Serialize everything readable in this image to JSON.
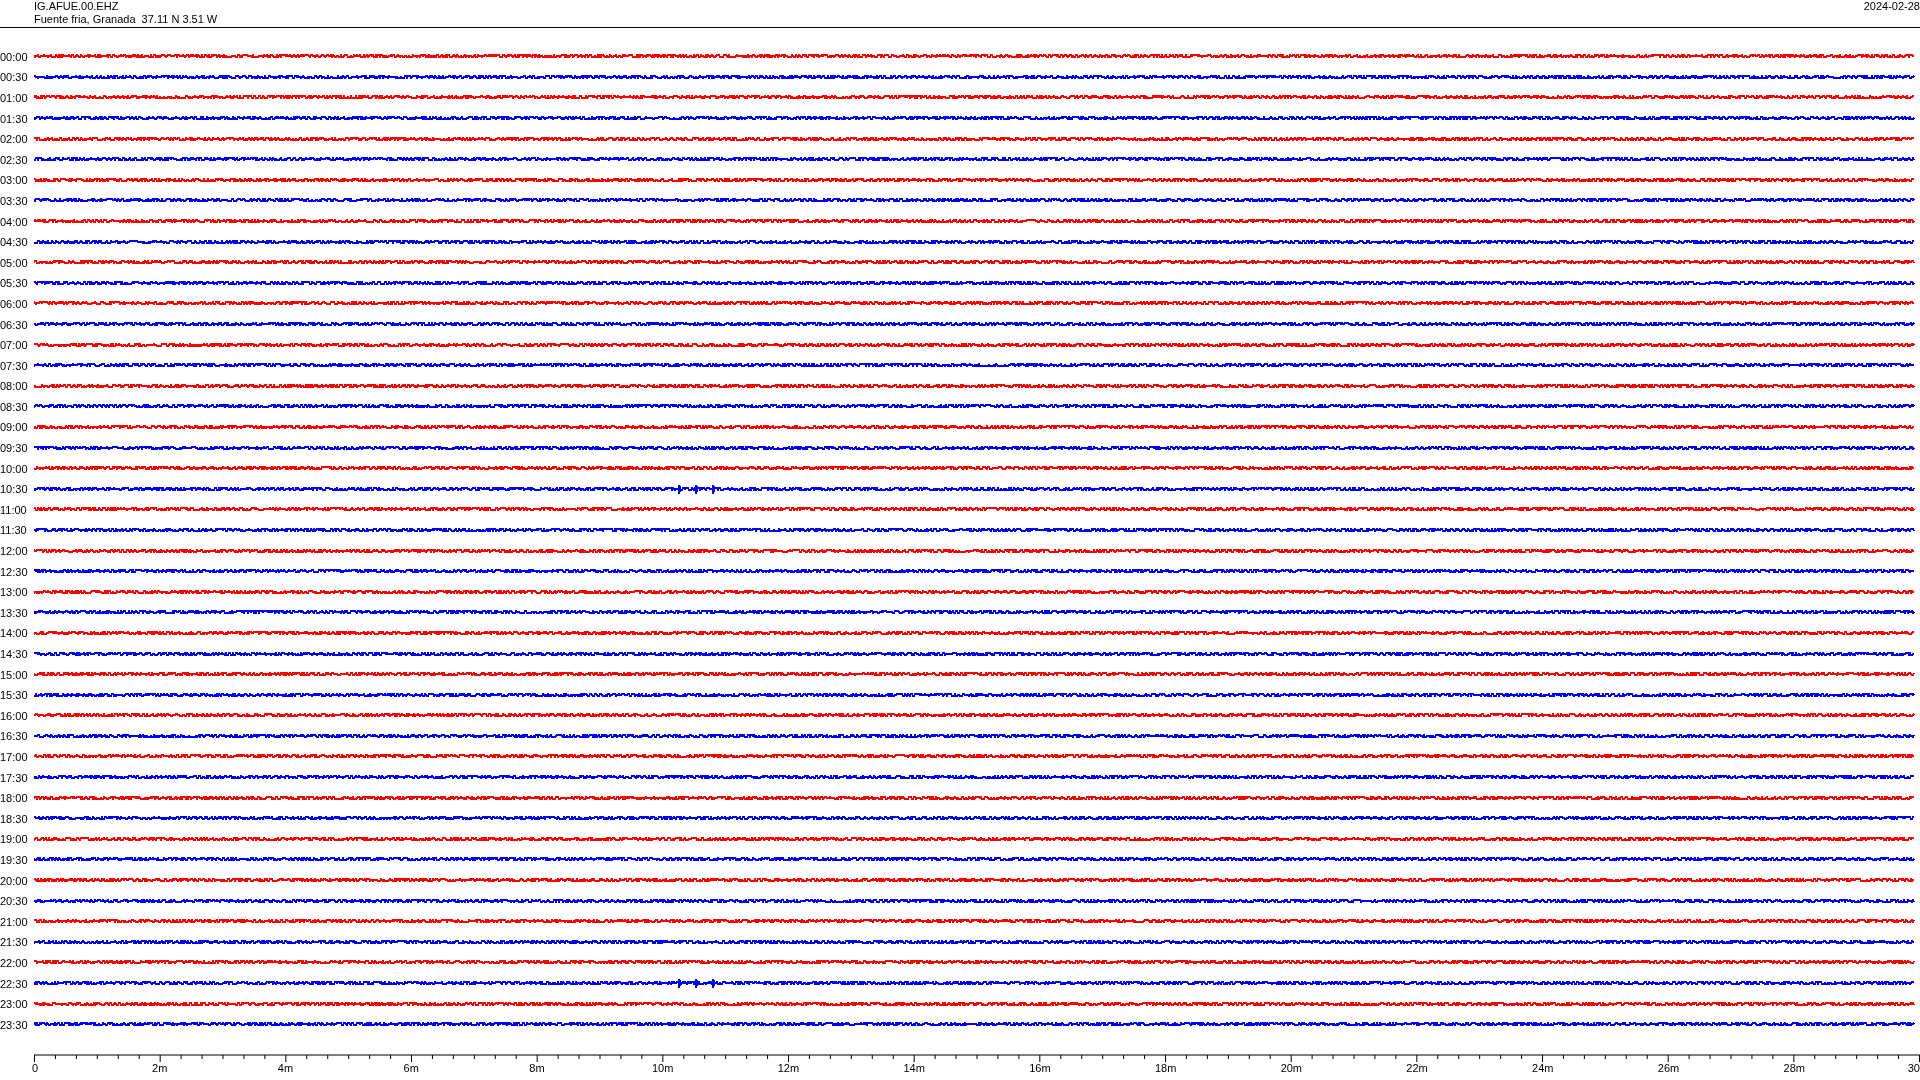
{
  "header": {
    "station": "IG.AFUE.00.EHZ",
    "location": "Fuente fria, Granada  37.11 N 3.51 W",
    "date": "2024-02-28"
  },
  "traces": [
    {
      "time": "00:00",
      "color": "#ff0000",
      "event": false
    },
    {
      "time": "00:30",
      "color": "#0000ff",
      "event": false
    },
    {
      "time": "01:00",
      "color": "#ff0000",
      "event": false
    },
    {
      "time": "01:30",
      "color": "#0000ff",
      "event": false
    },
    {
      "time": "02:00",
      "color": "#ff0000",
      "event": false
    },
    {
      "time": "02:30",
      "color": "#0000ff",
      "event": false
    },
    {
      "time": "03:00",
      "color": "#ff0000",
      "event": false
    },
    {
      "time": "03:30",
      "color": "#0000ff",
      "event": false
    },
    {
      "time": "04:00",
      "color": "#ff0000",
      "event": false
    },
    {
      "time": "04:30",
      "color": "#0000ff",
      "event": false
    },
    {
      "time": "05:00",
      "color": "#ff0000",
      "event": false
    },
    {
      "time": "05:30",
      "color": "#0000ff",
      "event": false
    },
    {
      "time": "06:00",
      "color": "#ff0000",
      "event": false
    },
    {
      "time": "06:30",
      "color": "#0000ff",
      "event": false
    },
    {
      "time": "07:00",
      "color": "#ff0000",
      "event": false
    },
    {
      "time": "07:30",
      "color": "#0000ff",
      "event": false
    },
    {
      "time": "08:00",
      "color": "#ff0000",
      "event": false
    },
    {
      "time": "08:30",
      "color": "#0000ff",
      "event": false
    },
    {
      "time": "09:00",
      "color": "#ff0000",
      "event": false
    },
    {
      "time": "09:30",
      "color": "#0000ff",
      "event": false
    },
    {
      "time": "10:00",
      "color": "#ff0000",
      "event": false
    },
    {
      "time": "10:30",
      "color": "#0000ff",
      "event": true
    },
    {
      "time": "11:00",
      "color": "#ff0000",
      "event": false
    },
    {
      "time": "11:30",
      "color": "#0000ff",
      "event": false
    },
    {
      "time": "12:00",
      "color": "#ff0000",
      "event": false
    },
    {
      "time": "12:30",
      "color": "#0000ff",
      "event": false
    },
    {
      "time": "13:00",
      "color": "#ff0000",
      "event": false
    },
    {
      "time": "13:30",
      "color": "#0000ff",
      "event": false
    },
    {
      "time": "14:00",
      "color": "#ff0000",
      "event": false
    },
    {
      "time": "14:30",
      "color": "#0000ff",
      "event": false
    },
    {
      "time": "15:00",
      "color": "#ff0000",
      "event": false
    },
    {
      "time": "15:30",
      "color": "#0000ff",
      "event": false
    },
    {
      "time": "16:00",
      "color": "#ff0000",
      "event": false
    },
    {
      "time": "16:30",
      "color": "#0000ff",
      "event": false
    },
    {
      "time": "17:00",
      "color": "#ff0000",
      "event": false
    },
    {
      "time": "17:30",
      "color": "#0000ff",
      "event": false
    },
    {
      "time": "18:00",
      "color": "#ff0000",
      "event": false
    },
    {
      "time": "18:30",
      "color": "#0000ff",
      "event": false
    },
    {
      "time": "19:00",
      "color": "#ff0000",
      "event": false
    },
    {
      "time": "19:30",
      "color": "#0000ff",
      "event": false
    },
    {
      "time": "20:00",
      "color": "#ff0000",
      "event": false
    },
    {
      "time": "20:30",
      "color": "#0000ff",
      "event": false
    },
    {
      "time": "21:00",
      "color": "#ff0000",
      "event": false
    },
    {
      "time": "21:30",
      "color": "#0000ff",
      "event": false
    },
    {
      "time": "22:00",
      "color": "#ff0000",
      "event": false
    },
    {
      "time": "22:30",
      "color": "#0000ff",
      "event": true
    },
    {
      "time": "23:00",
      "color": "#ff0000",
      "event": false
    },
    {
      "time": "23:30",
      "color": "#0000ff",
      "event": false
    }
  ],
  "axis": {
    "ticks": [
      "0",
      "2m",
      "4m",
      "6m",
      "8m",
      "10m",
      "12m",
      "14m",
      "16m",
      "18m",
      "20m",
      "22m",
      "24m",
      "26m",
      "28m",
      "30"
    ]
  }
}
